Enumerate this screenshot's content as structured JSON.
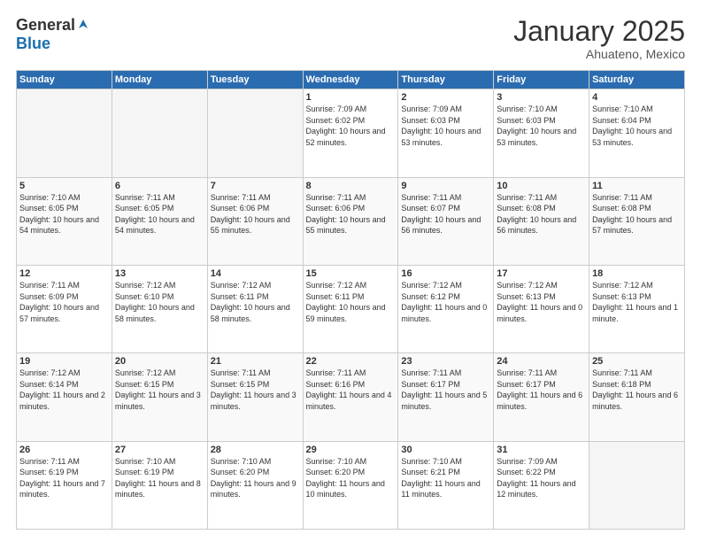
{
  "logo": {
    "general": "General",
    "blue": "Blue"
  },
  "header": {
    "month": "January 2025",
    "location": "Ahuateno, Mexico"
  },
  "weekdays": [
    "Sunday",
    "Monday",
    "Tuesday",
    "Wednesday",
    "Thursday",
    "Friday",
    "Saturday"
  ],
  "weeks": [
    [
      {
        "day": "",
        "sunrise": "",
        "sunset": "",
        "daylight": ""
      },
      {
        "day": "",
        "sunrise": "",
        "sunset": "",
        "daylight": ""
      },
      {
        "day": "",
        "sunrise": "",
        "sunset": "",
        "daylight": ""
      },
      {
        "day": "1",
        "sunrise": "Sunrise: 7:09 AM",
        "sunset": "Sunset: 6:02 PM",
        "daylight": "Daylight: 10 hours and 52 minutes."
      },
      {
        "day": "2",
        "sunrise": "Sunrise: 7:09 AM",
        "sunset": "Sunset: 6:03 PM",
        "daylight": "Daylight: 10 hours and 53 minutes."
      },
      {
        "day": "3",
        "sunrise": "Sunrise: 7:10 AM",
        "sunset": "Sunset: 6:03 PM",
        "daylight": "Daylight: 10 hours and 53 minutes."
      },
      {
        "day": "4",
        "sunrise": "Sunrise: 7:10 AM",
        "sunset": "Sunset: 6:04 PM",
        "daylight": "Daylight: 10 hours and 53 minutes."
      }
    ],
    [
      {
        "day": "5",
        "sunrise": "Sunrise: 7:10 AM",
        "sunset": "Sunset: 6:05 PM",
        "daylight": "Daylight: 10 hours and 54 minutes."
      },
      {
        "day": "6",
        "sunrise": "Sunrise: 7:11 AM",
        "sunset": "Sunset: 6:05 PM",
        "daylight": "Daylight: 10 hours and 54 minutes."
      },
      {
        "day": "7",
        "sunrise": "Sunrise: 7:11 AM",
        "sunset": "Sunset: 6:06 PM",
        "daylight": "Daylight: 10 hours and 55 minutes."
      },
      {
        "day": "8",
        "sunrise": "Sunrise: 7:11 AM",
        "sunset": "Sunset: 6:06 PM",
        "daylight": "Daylight: 10 hours and 55 minutes."
      },
      {
        "day": "9",
        "sunrise": "Sunrise: 7:11 AM",
        "sunset": "Sunset: 6:07 PM",
        "daylight": "Daylight: 10 hours and 56 minutes."
      },
      {
        "day": "10",
        "sunrise": "Sunrise: 7:11 AM",
        "sunset": "Sunset: 6:08 PM",
        "daylight": "Daylight: 10 hours and 56 minutes."
      },
      {
        "day": "11",
        "sunrise": "Sunrise: 7:11 AM",
        "sunset": "Sunset: 6:08 PM",
        "daylight": "Daylight: 10 hours and 57 minutes."
      }
    ],
    [
      {
        "day": "12",
        "sunrise": "Sunrise: 7:11 AM",
        "sunset": "Sunset: 6:09 PM",
        "daylight": "Daylight: 10 hours and 57 minutes."
      },
      {
        "day": "13",
        "sunrise": "Sunrise: 7:12 AM",
        "sunset": "Sunset: 6:10 PM",
        "daylight": "Daylight: 10 hours and 58 minutes."
      },
      {
        "day": "14",
        "sunrise": "Sunrise: 7:12 AM",
        "sunset": "Sunset: 6:11 PM",
        "daylight": "Daylight: 10 hours and 58 minutes."
      },
      {
        "day": "15",
        "sunrise": "Sunrise: 7:12 AM",
        "sunset": "Sunset: 6:11 PM",
        "daylight": "Daylight: 10 hours and 59 minutes."
      },
      {
        "day": "16",
        "sunrise": "Sunrise: 7:12 AM",
        "sunset": "Sunset: 6:12 PM",
        "daylight": "Daylight: 11 hours and 0 minutes."
      },
      {
        "day": "17",
        "sunrise": "Sunrise: 7:12 AM",
        "sunset": "Sunset: 6:13 PM",
        "daylight": "Daylight: 11 hours and 0 minutes."
      },
      {
        "day": "18",
        "sunrise": "Sunrise: 7:12 AM",
        "sunset": "Sunset: 6:13 PM",
        "daylight": "Daylight: 11 hours and 1 minute."
      }
    ],
    [
      {
        "day": "19",
        "sunrise": "Sunrise: 7:12 AM",
        "sunset": "Sunset: 6:14 PM",
        "daylight": "Daylight: 11 hours and 2 minutes."
      },
      {
        "day": "20",
        "sunrise": "Sunrise: 7:12 AM",
        "sunset": "Sunset: 6:15 PM",
        "daylight": "Daylight: 11 hours and 3 minutes."
      },
      {
        "day": "21",
        "sunrise": "Sunrise: 7:11 AM",
        "sunset": "Sunset: 6:15 PM",
        "daylight": "Daylight: 11 hours and 3 minutes."
      },
      {
        "day": "22",
        "sunrise": "Sunrise: 7:11 AM",
        "sunset": "Sunset: 6:16 PM",
        "daylight": "Daylight: 11 hours and 4 minutes."
      },
      {
        "day": "23",
        "sunrise": "Sunrise: 7:11 AM",
        "sunset": "Sunset: 6:17 PM",
        "daylight": "Daylight: 11 hours and 5 minutes."
      },
      {
        "day": "24",
        "sunrise": "Sunrise: 7:11 AM",
        "sunset": "Sunset: 6:17 PM",
        "daylight": "Daylight: 11 hours and 6 minutes."
      },
      {
        "day": "25",
        "sunrise": "Sunrise: 7:11 AM",
        "sunset": "Sunset: 6:18 PM",
        "daylight": "Daylight: 11 hours and 6 minutes."
      }
    ],
    [
      {
        "day": "26",
        "sunrise": "Sunrise: 7:11 AM",
        "sunset": "Sunset: 6:19 PM",
        "daylight": "Daylight: 11 hours and 7 minutes."
      },
      {
        "day": "27",
        "sunrise": "Sunrise: 7:10 AM",
        "sunset": "Sunset: 6:19 PM",
        "daylight": "Daylight: 11 hours and 8 minutes."
      },
      {
        "day": "28",
        "sunrise": "Sunrise: 7:10 AM",
        "sunset": "Sunset: 6:20 PM",
        "daylight": "Daylight: 11 hours and 9 minutes."
      },
      {
        "day": "29",
        "sunrise": "Sunrise: 7:10 AM",
        "sunset": "Sunset: 6:20 PM",
        "daylight": "Daylight: 11 hours and 10 minutes."
      },
      {
        "day": "30",
        "sunrise": "Sunrise: 7:10 AM",
        "sunset": "Sunset: 6:21 PM",
        "daylight": "Daylight: 11 hours and 11 minutes."
      },
      {
        "day": "31",
        "sunrise": "Sunrise: 7:09 AM",
        "sunset": "Sunset: 6:22 PM",
        "daylight": "Daylight: 11 hours and 12 minutes."
      },
      {
        "day": "",
        "sunrise": "",
        "sunset": "",
        "daylight": ""
      }
    ]
  ]
}
